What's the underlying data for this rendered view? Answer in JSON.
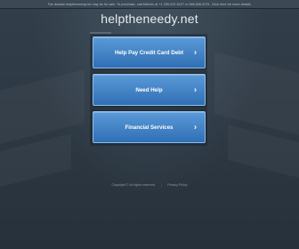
{
  "banner": {
    "text": "The domain helptheneedy.net may be for sale. To purchase, call Afternic at +1 339-222-5127 or 866-836-6791. Click here for more details."
  },
  "site": {
    "domain": "helptheneedy.net"
  },
  "links": [
    {
      "label": "Help Pay Credit Card Debt",
      "icon": "chevron-right-icon"
    },
    {
      "label": "Need Help",
      "icon": "chevron-right-icon"
    },
    {
      "label": "Financial Services",
      "icon": "chevron-right-icon"
    }
  ],
  "footer": {
    "copyright": "Copyright © All rights reserved.",
    "privacy": "Privacy Policy",
    "separator": "|"
  },
  "colors": {
    "background": "#2b3642",
    "button": "#3f82c7",
    "button_border": "#8fc0ee"
  }
}
